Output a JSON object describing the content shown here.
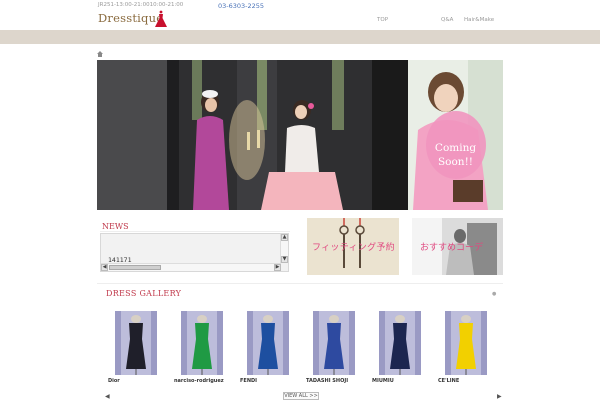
{
  "header": {
    "hours": "JR251-13:00-21:0010:00-21:00",
    "logo": "Dresstique",
    "phone": "03-6303-2255",
    "nav": {
      "top": "TOP",
      "qa": "Q&A",
      "hair": "Hair&Make"
    }
  },
  "side_photo": {
    "line1": "Coming",
    "line2": "Soon!!"
  },
  "news": {
    "title": "NEWS",
    "text": "141171",
    "scroll_up": "▲",
    "scroll_down": "▼",
    "scroll_left": "◀",
    "scroll_right": "▶"
  },
  "banners": {
    "fitting": "フィッティング予約",
    "coordinate": "おすすめコーデ"
  },
  "gallery": {
    "title": "DRESS GALLERY",
    "items": [
      {
        "brand": "Dior",
        "dress_color": "#1f1f2a"
      },
      {
        "brand": "narciso-rodriguez",
        "dress_color": "#1f9a44"
      },
      {
        "brand": "FENDI",
        "dress_color": "#1d4fa0"
      },
      {
        "brand": "TADASHI SHOJI",
        "dress_color": "#2e4aa0"
      },
      {
        "brand": "MIUMIU",
        "dress_color": "#1c2650"
      },
      {
        "brand": "CE'LINE",
        "dress_color": "#f2d000"
      }
    ],
    "view_all": "VIEW ALL >>",
    "prev": "◀",
    "next": "▶"
  },
  "colors": {
    "accent": "#c0394b",
    "phone": "#4a73b8",
    "band": "#ddd6cc",
    "pink_text": "#e0487f"
  }
}
